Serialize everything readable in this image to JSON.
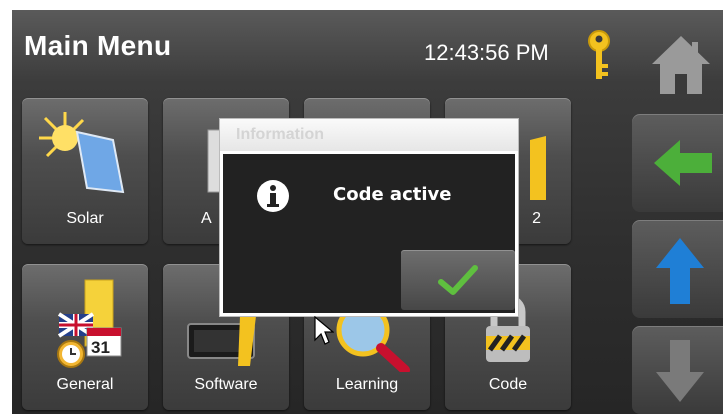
{
  "header": {
    "title": "Main Menu",
    "time": "12:43:56 PM"
  },
  "tiles": [
    {
      "label": "Solar",
      "icon": "solar-icon"
    },
    {
      "label": "A",
      "icon": "calendar-icon"
    },
    {
      "label": "",
      "icon": "tile-icon"
    },
    {
      "label": "2",
      "icon": "number-icon"
    },
    {
      "label": "General",
      "icon": "general-icon"
    },
    {
      "label": "Software",
      "icon": "software-icon"
    },
    {
      "label": "Learning",
      "icon": "magnifier-icon"
    },
    {
      "label": "Code",
      "icon": "padlock-icon"
    }
  ],
  "dialog": {
    "title": "Information",
    "message": "Code active",
    "icon": "info-icon",
    "ok_icon": "checkmark-icon"
  },
  "nav": {
    "home_icon": "home-icon",
    "back_icon": "arrow-left-icon",
    "up_icon": "arrow-up-icon",
    "down_icon": "arrow-down-icon"
  },
  "colors": {
    "accent_green": "#4caf3a",
    "accent_blue": "#1f7fd6",
    "key_yellow": "#f3c21f"
  }
}
